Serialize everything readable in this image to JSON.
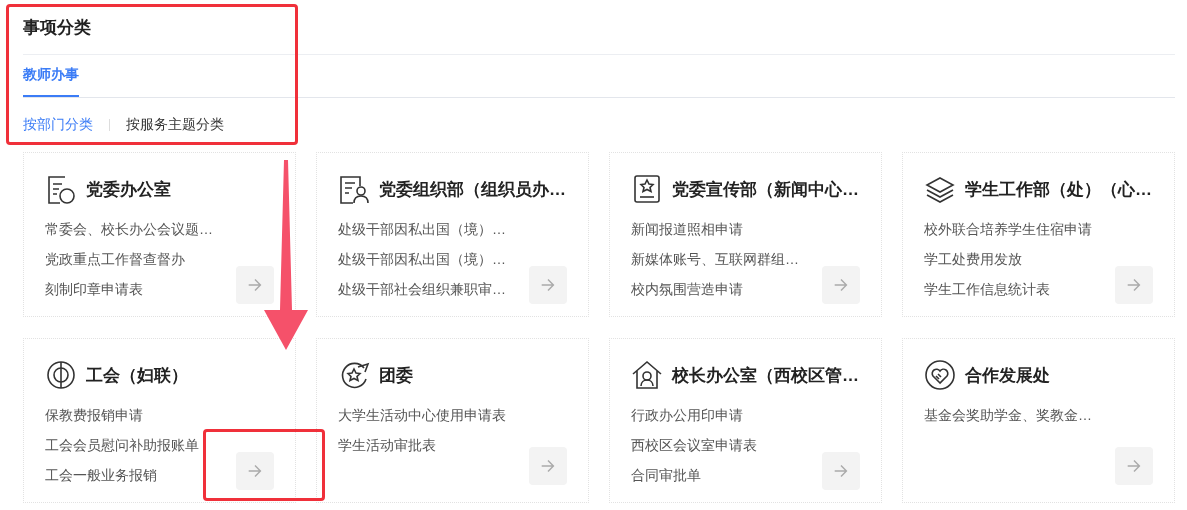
{
  "title": "事项分类",
  "tabs": [
    {
      "label": "教师办事",
      "selected": true
    }
  ],
  "subtabs": [
    {
      "label": "按部门分类",
      "selected": true
    },
    {
      "label": "按服务主题分类",
      "selected": false
    }
  ],
  "cards": [
    {
      "title": "党委办公室",
      "items": [
        "常委会、校长办公会议题…",
        "党政重点工作督查督办",
        "刻制印章申请表"
      ]
    },
    {
      "title": "党委组织部（组织员办…",
      "items": [
        "处级干部因私出国（境）…",
        "处级干部因私出国（境）…",
        "处级干部社会组织兼职审…"
      ]
    },
    {
      "title": "党委宣传部（新闻中心…",
      "items": [
        "新闻报道照相申请",
        "新媒体账号、互联网群组…",
        "校内氛围营造申请"
      ]
    },
    {
      "title": "学生工作部（处）（心…",
      "items": [
        "校外联合培养学生住宿申请",
        "学工处费用发放",
        "学生工作信息统计表"
      ]
    },
    {
      "title": "工会（妇联）",
      "items": [
        "保教费报销申请",
        "工会会员慰问补助报账单",
        "工会一般业务报销"
      ]
    },
    {
      "title": "团委",
      "items": [
        "大学生活动中心使用申请表",
        "学生活动审批表"
      ]
    },
    {
      "title": "校长办公室（西校区管…",
      "items": [
        "行政办公用印申请",
        "西校区会议室申请表",
        "合同审批单"
      ]
    },
    {
      "title": "合作发展处",
      "items": [
        "基金会奖助学金、奖教金…"
      ]
    }
  ],
  "annotations": [
    {
      "kind": "frame"
    },
    {
      "kind": "arrow"
    },
    {
      "kind": "frame"
    }
  ]
}
